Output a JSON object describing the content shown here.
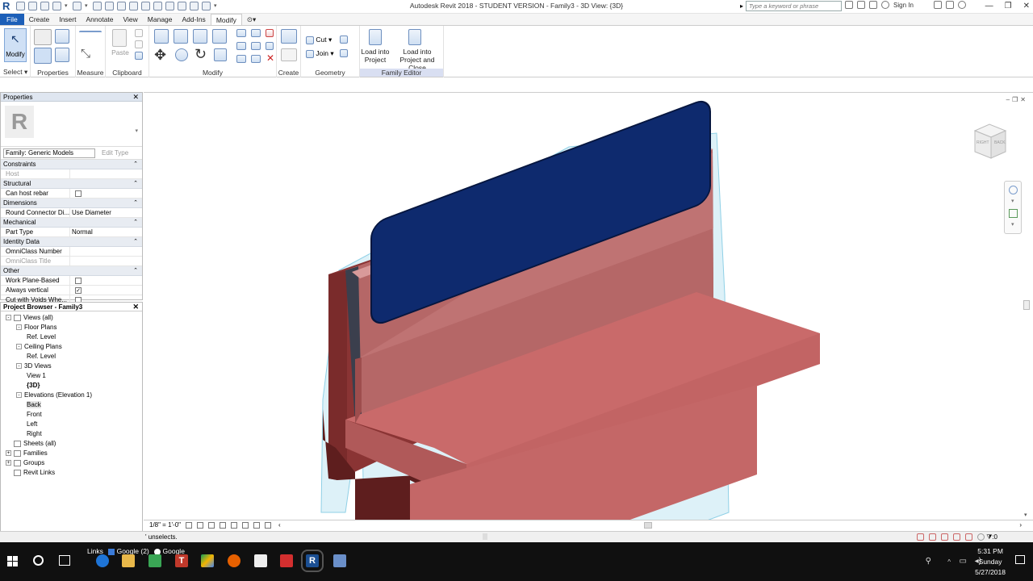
{
  "app": {
    "title": "Autodesk Revit 2018 - STUDENT VERSION -    Family3 - 3D View: {3D}",
    "search_placeholder": "Type a keyword or phrase",
    "sign_in": "Sign In"
  },
  "tabs": [
    {
      "label": "File"
    },
    {
      "label": "Create"
    },
    {
      "label": "Insert"
    },
    {
      "label": "Annotate"
    },
    {
      "label": "View"
    },
    {
      "label": "Manage"
    },
    {
      "label": "Add-Ins"
    },
    {
      "label": "Modify"
    }
  ],
  "ribbon": {
    "modify_label": "Modify",
    "panels": {
      "select": "Select",
      "properties": "Properties",
      "measure": "Measure",
      "clipboard": "Clipboard",
      "modify": "Modify",
      "create": "Create",
      "geometry": "Geometry",
      "family_editor": "Family Editor"
    },
    "paste_label": "Paste",
    "cut_label": "Cut",
    "join_label": "Join",
    "load_into_project": "Load into Project",
    "load_into_project_close": "Load into Project and Close"
  },
  "properties": {
    "title": "Properties",
    "family": "Family: Generic Models",
    "edit_type": "Edit Type",
    "groups": [
      {
        "name": "Constraints",
        "rows": [
          {
            "key": "Host",
            "value": "",
            "disabled": true
          }
        ]
      },
      {
        "name": "Structural",
        "rows": [
          {
            "key": "Can host rebar",
            "value": "",
            "checkbox": false
          }
        ]
      },
      {
        "name": "Dimensions",
        "rows": [
          {
            "key": "Round Connector Di...",
            "value": "Use Diameter"
          }
        ]
      },
      {
        "name": "Mechanical",
        "rows": [
          {
            "key": "Part Type",
            "value": "Normal"
          }
        ]
      },
      {
        "name": "Identity Data",
        "rows": [
          {
            "key": "OmniClass Number",
            "value": ""
          },
          {
            "key": "OmniClass Title",
            "value": "",
            "disabled": true
          }
        ]
      },
      {
        "name": "Other",
        "rows": [
          {
            "key": "Work Plane-Based",
            "value": "",
            "checkbox": false
          },
          {
            "key": "Always vertical",
            "value": "",
            "checkbox": true
          },
          {
            "key": "Cut with Voids Whe...",
            "value": "",
            "checkbox": false
          }
        ]
      }
    ]
  },
  "browser": {
    "title": "Project Browser - Family3",
    "items": [
      {
        "label": "Views (all)",
        "level": 0,
        "exp": "-"
      },
      {
        "label": "Floor Plans",
        "level": 1,
        "exp": "-"
      },
      {
        "label": "Ref. Level",
        "level": 2
      },
      {
        "label": "Ceiling Plans",
        "level": 1,
        "exp": "-"
      },
      {
        "label": "Ref. Level",
        "level": 2
      },
      {
        "label": "3D Views",
        "level": 1,
        "exp": "-"
      },
      {
        "label": "View 1",
        "level": 2
      },
      {
        "label": "{3D}",
        "level": 2,
        "bold": true
      },
      {
        "label": "Elevations (Elevation 1)",
        "level": 1,
        "exp": "-"
      },
      {
        "label": "Back",
        "level": 2,
        "selected": true
      },
      {
        "label": "Front",
        "level": 2
      },
      {
        "label": "Left",
        "level": 2
      },
      {
        "label": "Right",
        "level": 2
      },
      {
        "label": "Sheets (all)",
        "level": 0
      },
      {
        "label": "Families",
        "level": 0,
        "exp": "+"
      },
      {
        "label": "Groups",
        "level": 0,
        "exp": "+"
      },
      {
        "label": "Revit Links",
        "level": 0
      }
    ]
  },
  "viewport": {
    "navcube_right": "RIGHT",
    "navcube_back": "BACK",
    "scale": "1/8\" = 1'-0\""
  },
  "status": {
    "message": "' unselects.",
    "filter_count": ":0"
  },
  "taskbar": {
    "links": "Links",
    "google2": "Google (2)",
    "google": "Google",
    "time": "5:31 PM",
    "day": "Sunday",
    "date": "5/27/2018"
  },
  "colors": {
    "file_tab": "#1c5fb8",
    "bench_face": "#c96a6a",
    "panel_blue": "#0e2a6e",
    "taskbar": "#101010"
  }
}
